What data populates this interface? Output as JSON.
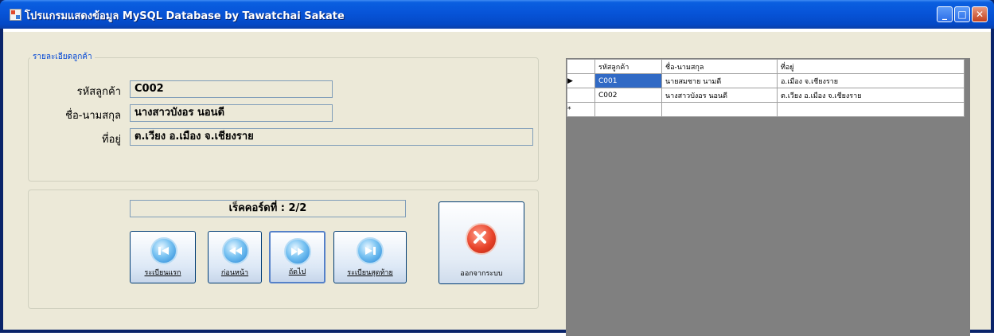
{
  "window": {
    "title": "โปรแกรมแสดงข้อมูล MySQL Database  by  Tawatchai Sakate",
    "minimize": "_",
    "maximize": "□",
    "close": "✕"
  },
  "customer_group": {
    "title": "รายละเอียดลูกค้า",
    "id_label": "รหัสลูกค้า",
    "id_value": "C002",
    "name_label": "ชื่อ-นามสกุล",
    "name_value": "นางสาวบังอร  นอนดี",
    "address_label": "ที่อยู่",
    "address_value": "ต.เวียง อ.เมือง จ.เชียงราย"
  },
  "navigation": {
    "record_text": "เร็คคอร์ดที่ : 2/2",
    "first_label": "ระเบียนแรก",
    "prev_label": "ก่อนหน้า",
    "next_label": "ถัดไป",
    "last_label": "ระเบียนสุดท้าย",
    "exit_label": "ออกจากระบบ"
  },
  "grid": {
    "columns": [
      "รหัสลูกค้า",
      "ชื่อ-นามสกุล",
      "ที่อยู่"
    ],
    "rows": [
      {
        "marker": "▶",
        "cells": [
          "C001",
          "นายสมชาย นามดี",
          "อ.เมือง จ.เชียงราย"
        ]
      },
      {
        "marker": "",
        "cells": [
          "C002",
          "นางสาวบังอร  นอนดี",
          "ต.เวียง อ.เมือง จ.เชียงราย"
        ]
      }
    ],
    "new_row_marker": "*"
  },
  "colors": {
    "titlebar": "#0754d8",
    "form_background": "#ece9d8",
    "grid_background": "#808080",
    "selected_cell": "#316ac5",
    "group_title": "#0046d5"
  },
  "icons": [
    "app-icon",
    "first-record-icon",
    "previous-record-icon",
    "next-record-icon",
    "last-record-icon",
    "exit-icon"
  ]
}
